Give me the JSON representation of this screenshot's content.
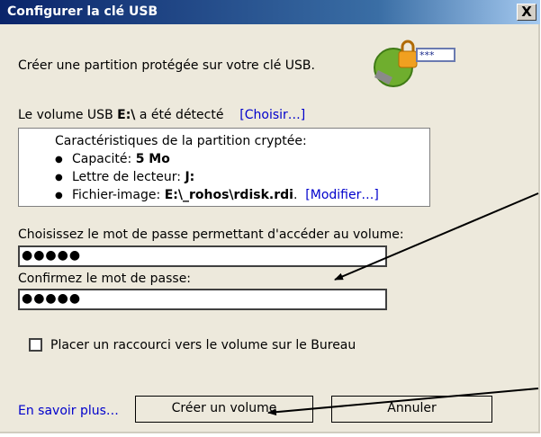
{
  "window": {
    "title": "Configurer la clé USB",
    "close_label": "X"
  },
  "intro_text": "Créer une partition protégée sur votre clé USB.",
  "logo": {
    "password_mask": "***"
  },
  "detected": {
    "prefix": "Le volume USB ",
    "drive": "E:\\",
    "suffix": " a été détecté",
    "choose_link": "[Choisir…]"
  },
  "partition": {
    "heading": "Caractéristiques de la partition cryptée:",
    "capacity_label": "Capacité: ",
    "capacity_value": "5 Mo",
    "letter_label": "Lettre de lecteur: ",
    "letter_value": "J:",
    "image_label": "Fichier-image: ",
    "image_value": "E:\\_rohos\\rdisk.rdi",
    "image_suffix": ".",
    "modify_link": "[Modifier…]"
  },
  "password": {
    "label": "Choisissez le mot de passe permettant d'accéder au volume:",
    "value": "●●●●●",
    "confirm_label": "Confirmez le mot de passe:",
    "confirm_value": "●●●●●"
  },
  "shortcut": {
    "label": "Placer un raccourci vers le volume sur le Bureau",
    "checked": false
  },
  "footer": {
    "learn_more": "En savoir plus…",
    "create_button": "Créer un volume",
    "cancel_button": "Annuler"
  }
}
